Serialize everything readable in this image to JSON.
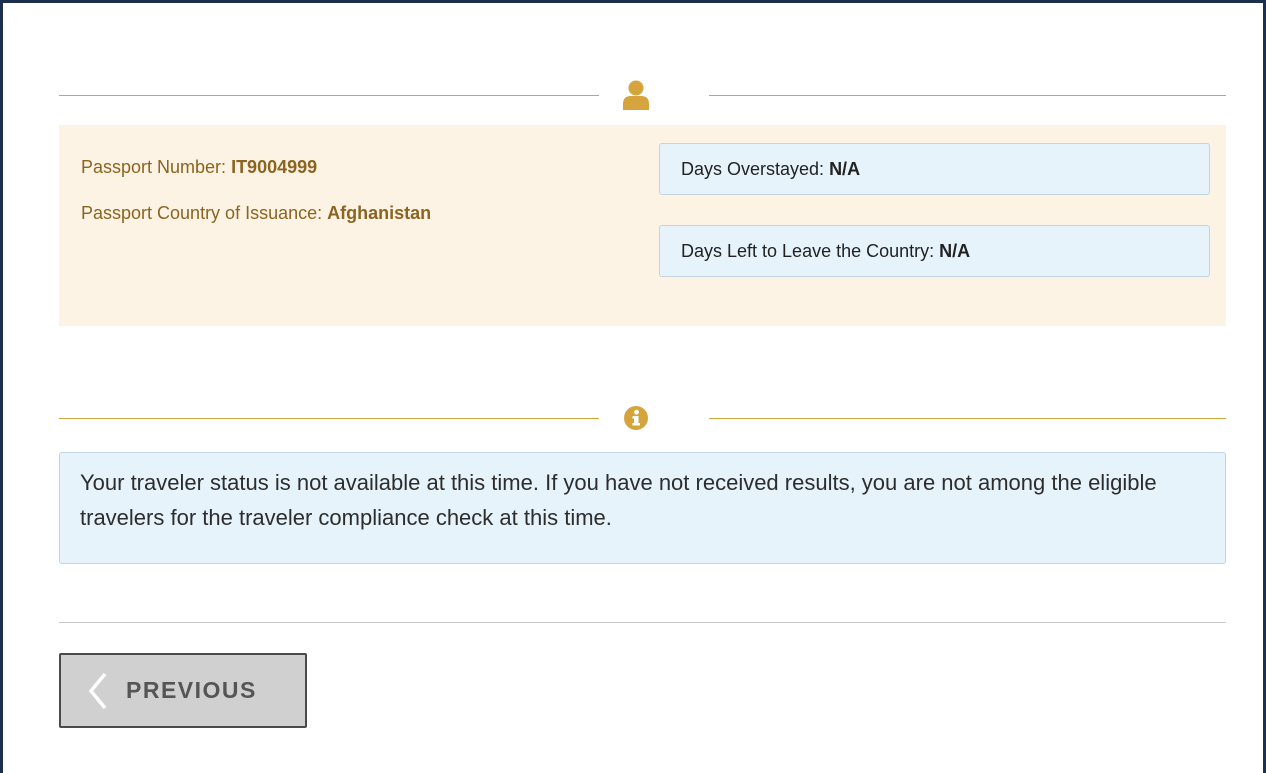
{
  "passport": {
    "number_label": "Passport Number: ",
    "number_value": "IT9004999",
    "country_label": "Passport Country of Issuance: ",
    "country_value": "Afghanistan"
  },
  "stats": {
    "overstayed_label": "Days Overstayed: ",
    "overstayed_value": "N/A",
    "days_left_label": "Days Left to Leave the Country: ",
    "days_left_value": "N/A"
  },
  "message": {
    "text": "Your traveler status is not available at this time. If you have not received results, you are not among the eligible travelers for the traveler compliance check at this time."
  },
  "navigation": {
    "previous_label": "PREVIOUS"
  },
  "icons": {
    "section1": "user-icon",
    "section2": "info-circle-icon",
    "previous": "chevron-left-icon"
  },
  "colors": {
    "accent_gold": "#d6a43c",
    "panel_cream": "#fdf3e4",
    "passport_text": "#8b6420",
    "info_blue_bg": "#e6f3fb",
    "frame_navy": "#1c2f4d",
    "button_gray": "#d0d0d0"
  }
}
